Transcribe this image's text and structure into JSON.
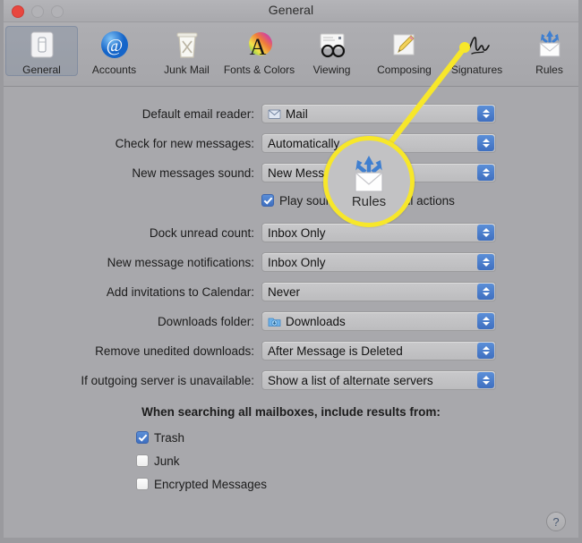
{
  "window": {
    "title": "General",
    "traffic_lights": [
      "close-button",
      "minimize-button",
      "zoom-button"
    ]
  },
  "toolbar": {
    "items": [
      {
        "label": "General",
        "icon": "general-icon",
        "selected": true
      },
      {
        "label": "Accounts",
        "icon": "accounts-at-icon",
        "selected": false
      },
      {
        "label": "Junk Mail",
        "icon": "junk-mail-icon",
        "selected": false
      },
      {
        "label": "Fonts & Colors",
        "icon": "fonts-colors-icon",
        "selected": false
      },
      {
        "label": "Viewing",
        "icon": "viewing-icon",
        "selected": false
      },
      {
        "label": "Composing",
        "icon": "composing-icon",
        "selected": false
      },
      {
        "label": "Signatures",
        "icon": "signatures-icon",
        "selected": false
      },
      {
        "label": "Rules",
        "icon": "rules-icon",
        "selected": false
      }
    ]
  },
  "settings": {
    "default_email_reader": {
      "label": "Default email reader:",
      "value": "Mail",
      "icon": "mail-app-icon"
    },
    "check_for_new_messages": {
      "label": "Check for new messages:",
      "value": "Automatically"
    },
    "new_messages_sound": {
      "label": "New messages sound:",
      "value": "New Messages Sound"
    },
    "play_sound_checkbox": {
      "label": "Play sound for other mail actions",
      "checked": true
    },
    "dock_unread_count": {
      "label": "Dock unread count:",
      "value": "Inbox Only"
    },
    "new_message_notifications": {
      "label": "New message notifications:",
      "value": "Inbox Only"
    },
    "add_invitations_calendar": {
      "label": "Add invitations to Calendar:",
      "value": "Never"
    },
    "downloads_folder": {
      "label": "Downloads folder:",
      "value": "Downloads",
      "icon": "downloads-folder-icon"
    },
    "remove_unedited_downloads": {
      "label": "Remove unedited downloads:",
      "value": "After Message is Deleted"
    },
    "outgoing_server_unavailable": {
      "label": "If outgoing server is unavailable:",
      "value": "Show a list of alternate servers"
    }
  },
  "search_section": {
    "heading": "When searching all mailboxes, include results from:",
    "options": [
      {
        "label": "Trash",
        "checked": true
      },
      {
        "label": "Junk",
        "checked": false
      },
      {
        "label": "Encrypted Messages",
        "checked": false
      }
    ]
  },
  "callout": {
    "magnifier_label": "Rules",
    "magnifier_icon": "rules-icon",
    "highlight_color": "#f7e72a",
    "target": "toolbar-item-rules"
  },
  "help_button": {
    "glyph": "?"
  },
  "colors": {
    "window_background": "#a8a8ac",
    "titlebar": "#b1b1b5",
    "accent_blue": "#4a7fd4",
    "highlight_yellow": "#f7e72a",
    "close_red": "#e8473f"
  }
}
